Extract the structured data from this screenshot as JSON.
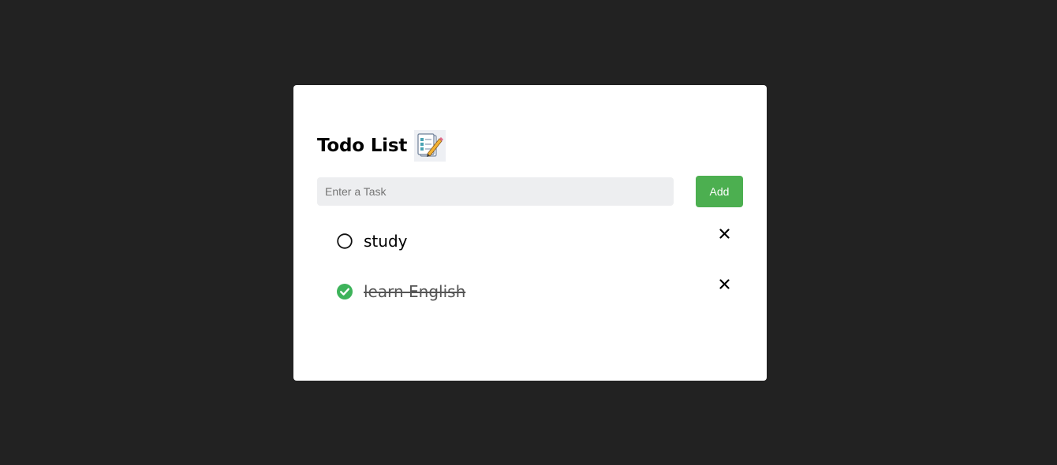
{
  "app": {
    "title": "Todo List",
    "title_icon": "notepad-pencil-icon"
  },
  "input": {
    "placeholder": "Enter a Task",
    "value": ""
  },
  "add_button": {
    "label": "Add",
    "color": "#4caf50"
  },
  "tasks": [
    {
      "text": "study",
      "done": false,
      "status_icon": "empty-circle-icon",
      "delete_icon": "close-icon"
    },
    {
      "text": "learn English",
      "done": true,
      "status_icon": "checked-circle-icon",
      "delete_icon": "close-icon"
    }
  ],
  "colors": {
    "background": "#222222",
    "card": "#ffffff",
    "accent": "#4caf50",
    "check": "#3db35a"
  }
}
